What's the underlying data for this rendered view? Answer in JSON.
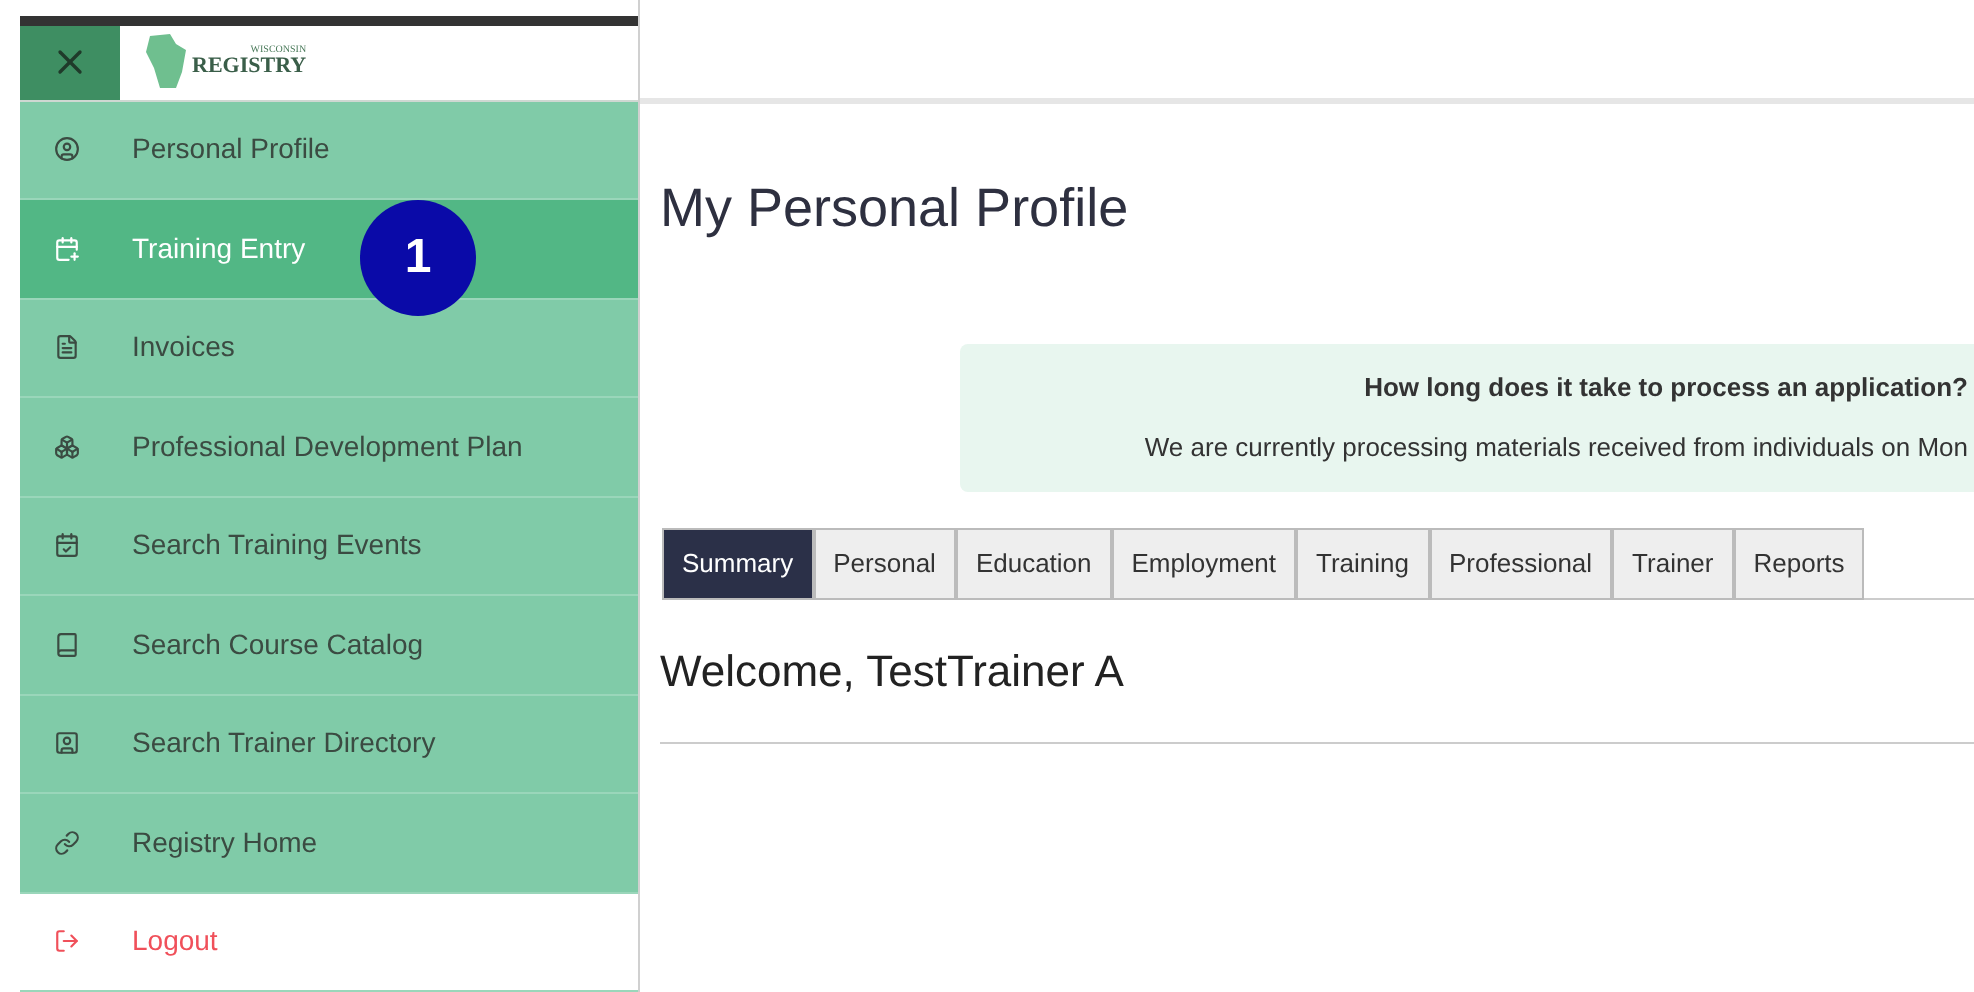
{
  "sidebar": {
    "logo": {
      "top": "WISCONSIN",
      "main": "REGISTRY"
    },
    "items": [
      {
        "label": "Personal Profile",
        "kind": "nav",
        "selected": false
      },
      {
        "label": "Training Entry",
        "kind": "nav",
        "selected": true
      },
      {
        "label": "Invoices",
        "kind": "nav",
        "selected": false
      },
      {
        "label": "Professional Development Plan",
        "kind": "nav",
        "selected": false
      },
      {
        "label": "Search Training Events",
        "kind": "nav",
        "selected": false
      },
      {
        "label": "Search Course Catalog",
        "kind": "nav",
        "selected": false
      },
      {
        "label": "Search Trainer Directory",
        "kind": "nav",
        "selected": false
      },
      {
        "label": "Registry Home",
        "kind": "nav",
        "selected": false
      },
      {
        "label": "Logout",
        "kind": "logout",
        "selected": false
      }
    ]
  },
  "callout": {
    "label": "1"
  },
  "page_title": "My Personal Profile",
  "notice": {
    "heading": "How long does it take to process an application?",
    "text": "We are currently processing materials received from individuals on Mon"
  },
  "tabs": [
    {
      "label": "Summary",
      "selected": true
    },
    {
      "label": "Personal",
      "selected": false
    },
    {
      "label": "Education",
      "selected": false
    },
    {
      "label": "Employment",
      "selected": false
    },
    {
      "label": "Training",
      "selected": false
    },
    {
      "label": "Professional",
      "selected": false
    },
    {
      "label": "Trainer",
      "selected": false
    },
    {
      "label": "Reports",
      "selected": false
    }
  ],
  "welcome": "Welcome, TestTrainer A"
}
